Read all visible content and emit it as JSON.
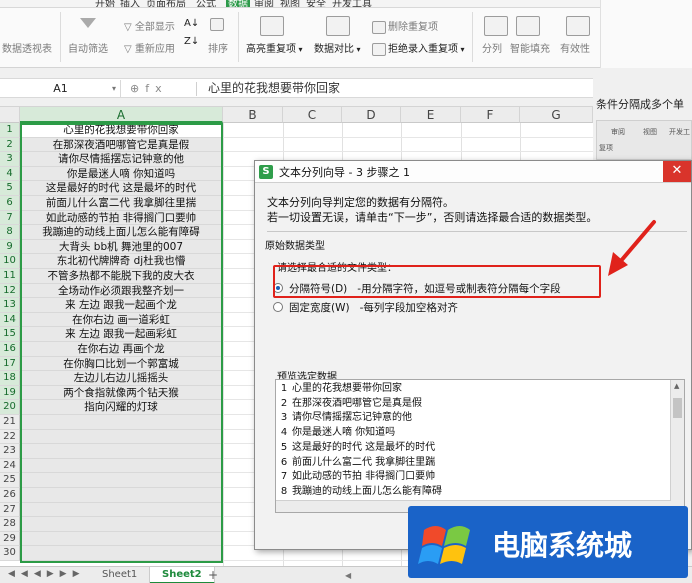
{
  "menu_tabs": [
    "开始",
    "插入",
    "页面布局",
    "公式",
    "数据",
    "审阅",
    "视图",
    "安全",
    "开发工具"
  ],
  "ribbon": {
    "pivot": "数据透视表",
    "autofilter": "自动筛选",
    "show_all": "全部显示",
    "reapply": "重新应用",
    "sort": "排序",
    "highlight_dup": "高亮重复项",
    "compare": "数据对比",
    "remove_dup": "删除重复项",
    "reject_dup": "拒绝录入重复项",
    "split": "分列",
    "smart_fill": "智能填充",
    "validity": "有效性"
  },
  "formula_bar": {
    "cell_ref": "A1",
    "content": "心里的花我想要带你回家"
  },
  "columns": [
    "A",
    "B",
    "C",
    "D",
    "E",
    "F",
    "G"
  ],
  "rows": [
    "1",
    "2",
    "3",
    "4",
    "5",
    "6",
    "7",
    "8",
    "9",
    "10",
    "11",
    "12",
    "13",
    "14",
    "15",
    "16",
    "17",
    "18",
    "19",
    "20",
    "21",
    "22",
    "23",
    "24",
    "25",
    "26",
    "27",
    "28",
    "29",
    "30"
  ],
  "cells_a": [
    "心里的花我想要带你回家",
    "在那深夜酒吧哪管它是真是假",
    "请你尽情摇摆忘记钟意的他",
    "你是最迷人嘀 你知道吗",
    "这是最好的时代 这是最坏的时代",
    "前面儿什么富二代 我拿脚往里揣",
    "如此动感的节拍 非得搁门口要帅",
    "我蹦迪的动线上面儿怎么能有障碍",
    "大背头 bb机 舞池里的007",
    "东北初代牌牌奇 dj杜我也懵",
    "不管多热都不能脱下我的皮大衣",
    "全场动作必须跟我整齐划一",
    "来 左边 跟我一起画个龙",
    "在你右边 画一道彩虹",
    "来 左边 跟我一起画彩虹",
    "在你右边 再画个龙",
    "在你胸口比划一个郭富城",
    "左边儿右边儿摇摇头",
    "两个食指就像两个钻天猴",
    "指向闪耀的灯球",
    "",
    "",
    "",
    "",
    "",
    "",
    "",
    "",
    "",
    ""
  ],
  "sheet_tabs": [
    "Sheet1",
    "Sheet2"
  ],
  "side_peek": {
    "text": "条件分隔成多个单",
    "tabs": [
      "审阅",
      "视图",
      "开发工"
    ],
    "sub": "复项"
  },
  "dialog": {
    "title": "文本分列向导 - 3 步骤之 1",
    "line1": "文本分列向导判定您的数据有分隔符。",
    "line2": "若一切设置无误，请单击“下一步”，否则请选择最合适的数据类型。",
    "group_label": "原始数据类型",
    "type_prompt": "请选择最合适的文件类型：",
    "opt1_label": "分隔符号(D)",
    "opt1_desc": "-用分隔字符，如逗号或制表符分隔每个字段",
    "opt2_label": "固定宽度(W)",
    "opt2_desc": "-每列字段加空格对齐",
    "preview_label": "预览选定数据",
    "preview_rows": [
      {
        "n": "1",
        "t": "心里的花我想要带你回家"
      },
      {
        "n": "2",
        "t": "在那深夜酒吧哪管它是真是假"
      },
      {
        "n": "3",
        "t": "请你尽情摇摆忘记钟意的他"
      },
      {
        "n": "4",
        "t": "你是最迷人嘀 你知道吗"
      },
      {
        "n": "5",
        "t": "这是最好的时代 这是最坏的时代"
      },
      {
        "n": "6",
        "t": "前面儿什么富二代 我拿脚往里踹"
      },
      {
        "n": "7",
        "t": "如此动感的节拍 非得搁门口要帅"
      },
      {
        "n": "8",
        "t": "我蹦迪的动线上面儿怎么能有障碍"
      },
      {
        "n": "9",
        "t": "大背头 bb机 舞池里的007"
      }
    ]
  },
  "watermark": {
    "text": "电脑系统城"
  },
  "colors": {
    "accent_green": "#2c9b46",
    "red_highlight": "#e0221b",
    "watermark_blue": "#1a63c8"
  }
}
